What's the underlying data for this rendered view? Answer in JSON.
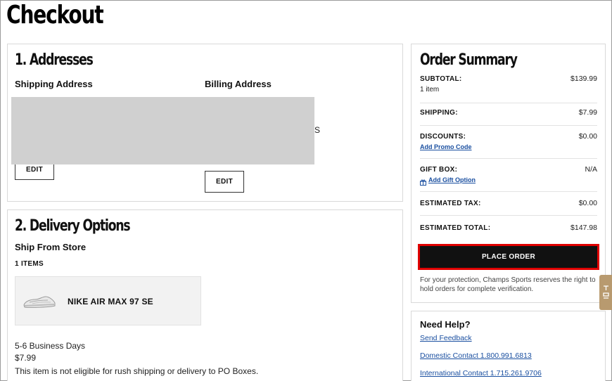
{
  "page": {
    "title": "Checkout"
  },
  "addresses": {
    "title": "1. Addresses",
    "shipping_label": "Shipping Address",
    "billing_label": "Billing Address",
    "shipping_edit": "EDIT",
    "billing_edit": "EDIT",
    "billing_fragment": "S"
  },
  "delivery": {
    "title": "2. Delivery Options",
    "method": "Ship From Store",
    "items_count": "1 ITEMS",
    "product_name": "NIKE AIR MAX 97 SE",
    "timeframe": "5-6 Business Days",
    "price": "$7.99",
    "notice": "This item is not eligible for rush shipping or delivery to PO Boxes."
  },
  "summary": {
    "title": "Order Summary",
    "subtotal_label": "SUBTOTAL:",
    "subtotal_value": "$139.99",
    "subtotal_items": "1 item",
    "shipping_label": "SHIPPING:",
    "shipping_value": "$7.99",
    "discounts_label": "DISCOUNTS:",
    "discounts_value": "$0.00",
    "promo_link": "Add Promo Code",
    "giftbox_label": "GIFT BOX:",
    "giftbox_value": "N/A",
    "gift_link": "Add Gift Option",
    "tax_label": "ESTIMATED TAX:",
    "tax_value": "$0.00",
    "total_label": "ESTIMATED TOTAL:",
    "total_value": "$147.98",
    "place_order": "PLACE ORDER",
    "protection_note": "For your protection, Champs Sports reserves the right to hold orders for complete verification."
  },
  "help": {
    "title": "Need Help?",
    "feedback_link": "Send Feedback",
    "domestic_link": "Domestic Contact 1.800.991.6813",
    "international_link": "International Contact 1.715.261.9706"
  },
  "colors": {
    "accent_red": "#e00000",
    "link_blue": "#1a4fa0",
    "button_black": "#111111"
  }
}
